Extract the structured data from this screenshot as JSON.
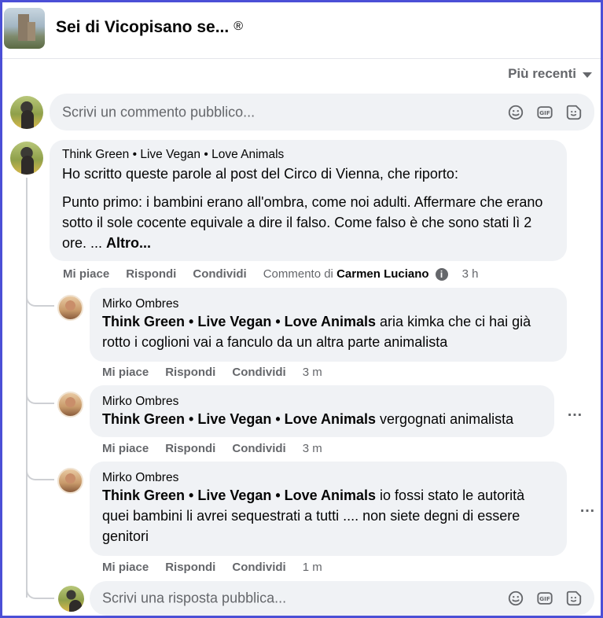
{
  "header": {
    "group_name": "Sei di Vicopisano se...",
    "reg_mark": "®"
  },
  "sort": {
    "label": "Più recenti",
    "icon": "caret-down-icon"
  },
  "composer": {
    "placeholder": "Scrivi un commento pubblico...",
    "icons": [
      "emoji-icon",
      "gif-icon",
      "sticker-icon"
    ]
  },
  "main_comment": {
    "author": "Think Green • Live Vegan • Love Animals",
    "line1": "Ho scritto queste parole al post del Circo di Vienna, che riporto:",
    "para2": "Punto primo: i bambini erano all'ombra, come noi adulti. Affermare che erano sotto il sole cocente equivale a dire il falso. Come falso è che sono stati lì 2 ore. ...",
    "more": "Altro...",
    "actions": {
      "like": "Mi piace",
      "reply": "Rispondi",
      "share": "Condividi"
    },
    "meta_prefix": "Commento di",
    "meta_user": "Carmen Luciano",
    "time": "3 h"
  },
  "replies": [
    {
      "author": "Mirko Ombres",
      "tag": "Think Green • Live Vegan • Love Animals",
      "text": " aria kimka che ci hai già rotto i coglioni vai a fanculo da un altra parte animalista",
      "like": "Mi piace",
      "reply": "Rispondi",
      "share": "Condividi",
      "time": "3 m"
    },
    {
      "author": "Mirko Ombres",
      "tag": "Think Green • Live Vegan • Love Animals",
      "text": " vergognati animalista",
      "like": "Mi piace",
      "reply": "Rispondi",
      "share": "Condividi",
      "time": "3 m",
      "more_icon": "…"
    },
    {
      "author": "Mirko Ombres",
      "tag": "Think Green • Live Vegan • Love Animals",
      "text": " io fossi stato le autorità quei bambini li avrei sequestrati a tutti .... non siete degni di essere genitori",
      "like": "Mi piace",
      "reply": "Rispondi",
      "share": "Condividi",
      "time": "1 m",
      "more_icon": "…"
    }
  ],
  "reply_composer": {
    "placeholder": "Scrivi una risposta pubblica..."
  },
  "colors": {
    "frame": "#4b4fd6",
    "bubble": "#f0f2f5",
    "muted": "#65676b"
  }
}
